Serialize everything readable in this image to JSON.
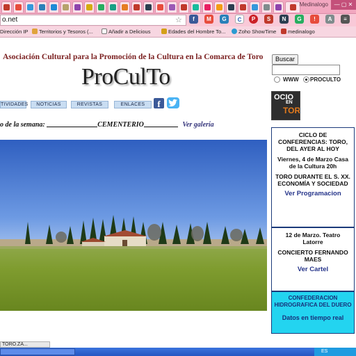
{
  "browser": {
    "window_title": "Medinalogo",
    "url_fragment": "o.net",
    "bookmarks": [
      "Dirección IP",
      "Territorios y Tesoros (...",
      "Añadir a Delicious",
      "Edades del Hombre To...",
      "Zoho ShowTime",
      "medinalogo"
    ]
  },
  "site": {
    "org_title": "Asociación Cultural para la Promoción de la Cultura en la Comarca de Toro",
    "logo": "ProCulTo",
    "nav": [
      "TIVIDADES",
      "NOTICIAS",
      "REVISTAS",
      "ENLACES"
    ],
    "facebook_glyph": "f",
    "photo_of_week_prefix": "o de la semana:",
    "photo_of_week_name": "CEMENTERIO",
    "gallery_link": "Ver galería"
  },
  "search": {
    "button_label": "Buscar",
    "input_value": "",
    "options": [
      "WWW",
      "PROCULTO"
    ],
    "selected": "PROCULTO"
  },
  "ocio_banner": {
    "line1": "OCIO",
    "line2": "EN",
    "line3": "TORO"
  },
  "events": {
    "box1": {
      "title": "CICLO DE CONFERENCIAS: TORO, DEL AYER AL HOY",
      "when": "Viernes, 4 de Marzo Casa de la Cultura 20h",
      "topic": "TORO DURANTE EL S. XX. ECONOMÍA Y SOCIEDAD",
      "link": "Ver Programacion"
    },
    "box2": {
      "title": "12 de Marzo. Teatro Latorre",
      "topic": "CONCIERTO FERNANDO MAES",
      "link": "Ver Cartel"
    },
    "box3": {
      "title": "CONFEDERACION HIDROGRAFICA DEL DUERO",
      "sub": "Datos en tiempo real"
    }
  },
  "status_bar": "TORO.ZA...",
  "taskbar": {
    "lang": "ES"
  },
  "colors": {
    "chrome_pink": "#f2a7c0",
    "title_red": "#7a1f1f",
    "link_blue": "#25348a",
    "cyan_box": "#23d4f0"
  }
}
